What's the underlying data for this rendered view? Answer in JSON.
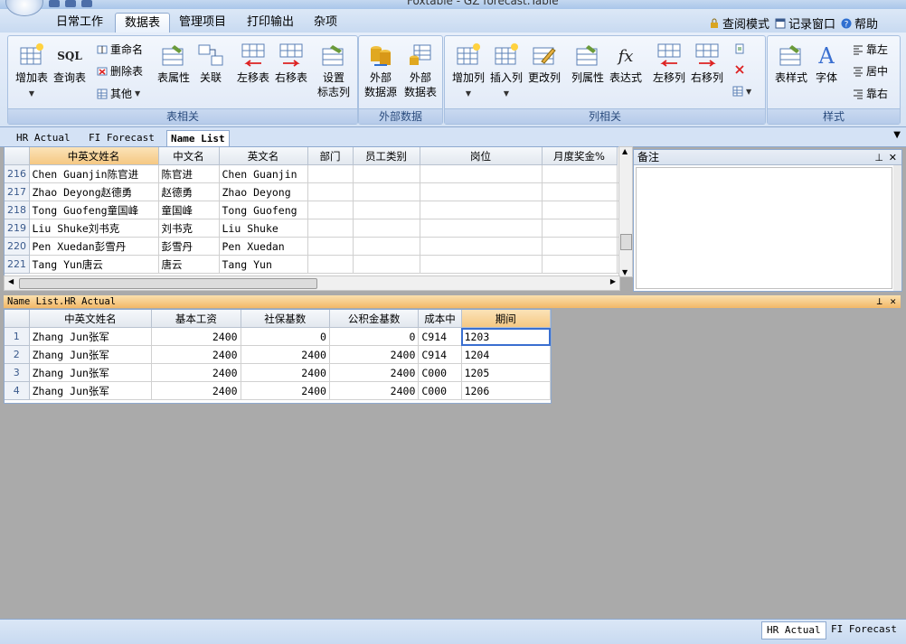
{
  "window": {
    "title": "Foxtable - GZ forecast.Table"
  },
  "ribbon_tabs": [
    "日常工作",
    "数据表",
    "管理项目",
    "打印输出",
    "杂项"
  ],
  "ribbon_right": {
    "query_mode": "查阅模式",
    "record_window": "记录窗口",
    "help": "帮助"
  },
  "groups": {
    "table": {
      "label": "表相关",
      "add_table": "增加表",
      "query_table": "查询表",
      "rename": "重命名",
      "delete_table": "删除表",
      "other": "其他",
      "table_props": "表属性",
      "relation": "关联",
      "move_left": "左移表",
      "move_right": "右移表",
      "set_flag_1": "设置",
      "set_flag_2": "标志列"
    },
    "external": {
      "label": "外部数据",
      "ext_source_1": "外部",
      "ext_source_2": "数据源",
      "ext_table_1": "外部",
      "ext_table_2": "数据表"
    },
    "column": {
      "label": "列相关",
      "add_col": "增加列",
      "insert_col": "插入列",
      "change_col": "更改列",
      "col_props": "列属性",
      "expression": "表达式",
      "col_left": "左移列",
      "col_right": "右移列"
    },
    "style": {
      "label": "样式",
      "table_style": "表样式",
      "font": "字体",
      "align_left": "靠左",
      "align_center": "居中",
      "align_right": "靠右"
    }
  },
  "doc_tabs": [
    "HR Actual",
    "FI Forecast",
    "Name List"
  ],
  "top_grid": {
    "headers": [
      "中英文姓名",
      "中文名",
      "英文名",
      "部门",
      "员工类别",
      "岗位",
      "月度奖金%"
    ],
    "rows": [
      {
        "n": "216",
        "c": [
          "Chen Guanjin陈官进",
          "陈官进",
          "Chen Guanjin",
          "",
          "",
          "",
          ""
        ]
      },
      {
        "n": "217",
        "c": [
          "Zhao Deyong赵德勇",
          "赵德勇",
          "Zhao Deyong",
          "",
          "",
          "",
          ""
        ]
      },
      {
        "n": "218",
        "c": [
          "Tong Guofeng童国峰",
          "童国峰",
          "Tong Guofeng",
          "",
          "",
          "",
          ""
        ]
      },
      {
        "n": "219",
        "c": [
          "Liu Shuke刘书克",
          "刘书克",
          "Liu Shuke",
          "",
          "",
          "",
          ""
        ]
      },
      {
        "n": "220",
        "c": [
          "Pen Xuedan彭雪丹",
          "彭雪丹",
          "Pen Xuedan",
          "",
          "",
          "",
          ""
        ]
      },
      {
        "n": "221",
        "c": [
          "Tang Yun唐云",
          "唐云",
          "Tang Yun",
          "",
          "",
          "",
          ""
        ]
      }
    ]
  },
  "note_panel": {
    "title": "备注"
  },
  "child_bar": {
    "title": "Name List.HR Actual"
  },
  "bottom_grid": {
    "headers": [
      "中英文姓名",
      "基本工资",
      "社保基数",
      "公积金基数",
      "成本中",
      "期间"
    ],
    "rows": [
      {
        "n": "1",
        "c": [
          "Zhang Jun张军",
          "2400",
          "0",
          "0",
          "C914",
          "1203"
        ]
      },
      {
        "n": "2",
        "c": [
          "Zhang Jun张军",
          "2400",
          "2400",
          "2400",
          "C914",
          "1204"
        ]
      },
      {
        "n": "3",
        "c": [
          "Zhang Jun张军",
          "2400",
          "2400",
          "2400",
          "C000",
          "1205"
        ]
      },
      {
        "n": "4",
        "c": [
          "Zhang Jun张军",
          "2400",
          "2400",
          "2400",
          "C000",
          "1206"
        ]
      }
    ]
  },
  "status_tabs": [
    "HR Actual",
    "FI Forecast"
  ],
  "colors": {
    "accent_orange": "#f5c883",
    "ribbon_blue": "#d6e3f4",
    "grid_border": "#8ea9cf"
  }
}
